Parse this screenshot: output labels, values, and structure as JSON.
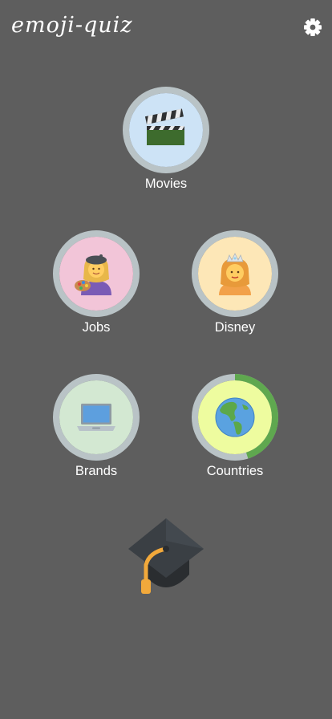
{
  "header": {
    "title": "emoji-quiz",
    "settings_icon": "gear-icon"
  },
  "categories": [
    {
      "label": "Movies",
      "icon": "clapper-board-icon",
      "bg": "#cde3f6",
      "progress": 0
    },
    {
      "label": "Jobs",
      "icon": "woman-artist-icon",
      "bg": "#f2c5d8",
      "progress": 0
    },
    {
      "label": "Disney",
      "icon": "princess-icon",
      "bg": "#fde7b7",
      "progress": 0
    },
    {
      "label": "Brands",
      "icon": "laptop-icon",
      "bg": "#d3e8d2",
      "progress": 0
    },
    {
      "label": "Countries",
      "icon": "globe-americas-icon",
      "bg": "#eefc9f",
      "progress": 0.45
    }
  ],
  "footer": {
    "icon": "graduation-cap-icon"
  },
  "colors": {
    "background": "#5e5e5e",
    "ring_track": "#b9c3c6",
    "ring_progress": "#5fa84f"
  }
}
